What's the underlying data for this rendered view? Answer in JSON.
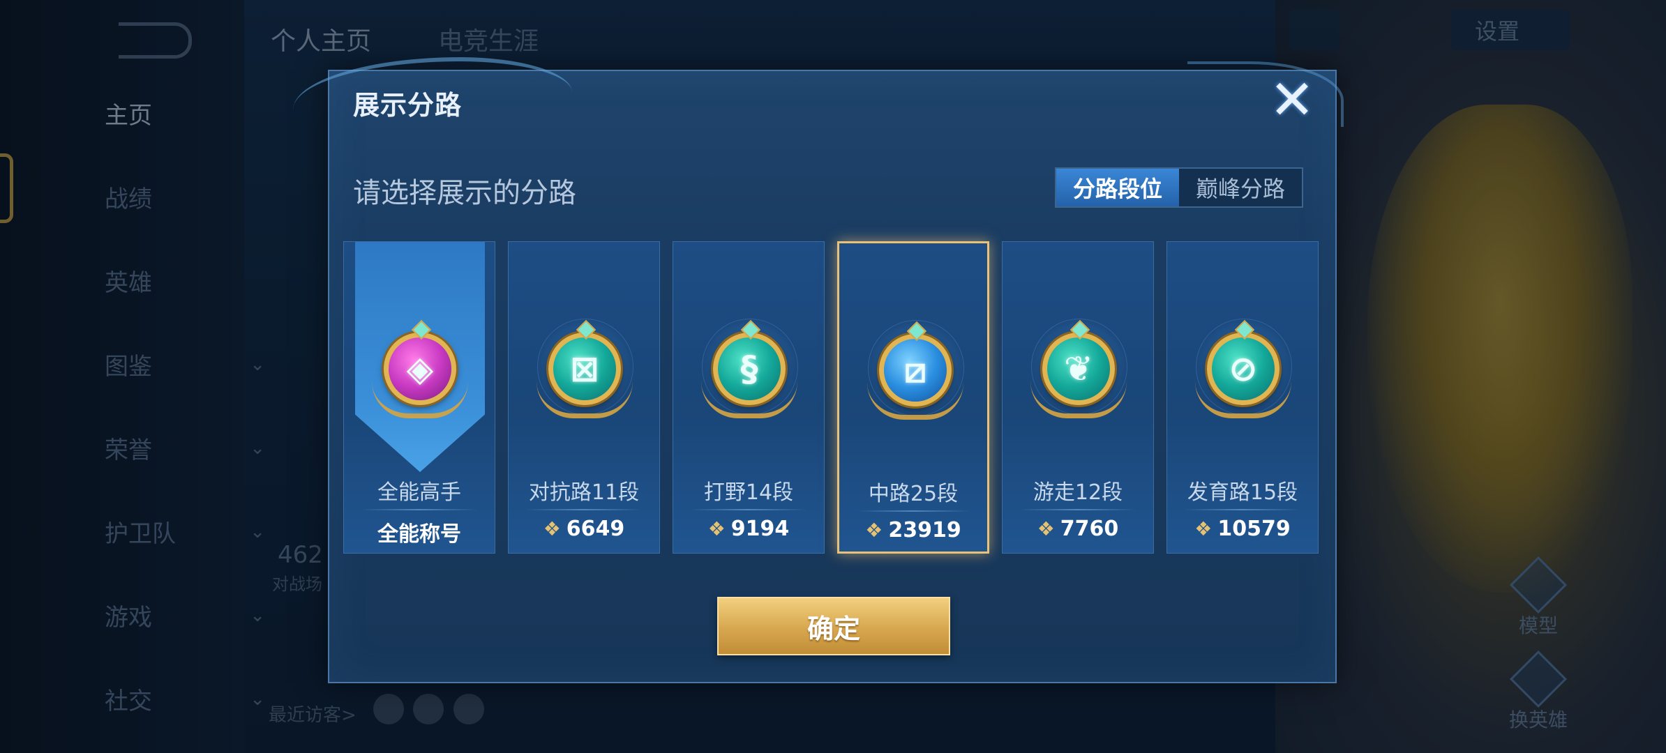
{
  "background": {
    "top_tabs": [
      "个人主页",
      "电竞生涯"
    ],
    "settings_label": "设置",
    "nav": [
      {
        "label": "主页",
        "has_chevron": false
      },
      {
        "label": "战绩",
        "has_chevron": false
      },
      {
        "label": "英雄",
        "has_chevron": false
      },
      {
        "label": "图鉴",
        "has_chevron": true
      },
      {
        "label": "荣誉",
        "has_chevron": true
      },
      {
        "label": "护卫队",
        "has_chevron": true
      },
      {
        "label": "游戏",
        "has_chevron": true
      },
      {
        "label": "社交",
        "has_chevron": true
      }
    ],
    "nav_chevron": "⌄",
    "score_partial": "462",
    "score_label_partial": "对战场",
    "recent_visitors": "最近访客>",
    "right_buttons": [
      "模型",
      "换英雄"
    ]
  },
  "dialog": {
    "title": "展示分路",
    "close_icon": "✕",
    "subtitle": "请选择展示的分路",
    "toggle": [
      {
        "label": "分路段位",
        "active": true
      },
      {
        "label": "巅峰分路",
        "active": false
      }
    ],
    "point_icon": "❖",
    "cards": [
      {
        "label": "全能高手",
        "value": "全能称号",
        "icon": "all-round-icon",
        "glyph": "◈",
        "color": "magenta",
        "selected": false,
        "pennant": true
      },
      {
        "label": "对抗路11段",
        "value": "6649",
        "icon": "clash-lane-icon",
        "glyph": "⊠",
        "color": "teal",
        "selected": false,
        "pennant": false
      },
      {
        "label": "打野14段",
        "value": "9194",
        "icon": "jungle-dragon-icon",
        "glyph": "§",
        "color": "teal",
        "selected": false,
        "pennant": false
      },
      {
        "label": "中路25段",
        "value": "23919",
        "icon": "mid-lane-icon",
        "glyph": "⧄",
        "color": "blue",
        "selected": true,
        "pennant": false
      },
      {
        "label": "游走12段",
        "value": "7760",
        "icon": "roam-wings-icon",
        "glyph": "❦",
        "color": "teal",
        "selected": false,
        "pennant": false
      },
      {
        "label": "发育路15段",
        "value": "10579",
        "icon": "farm-lane-icon",
        "glyph": "⊘",
        "color": "teal",
        "selected": false,
        "pennant": false
      }
    ],
    "confirm_label": "确定"
  }
}
